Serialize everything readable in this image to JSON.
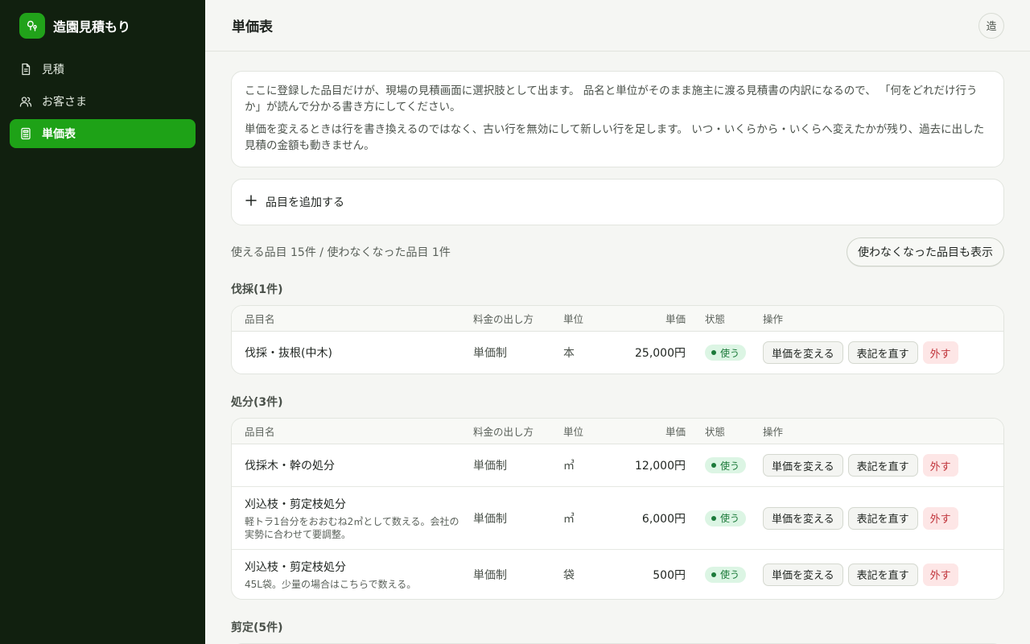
{
  "app": {
    "name": "造園見積もり",
    "logo_icon": "tree-icon",
    "brand_color": "#21a21a"
  },
  "sidebar": {
    "items": [
      {
        "label": "見積",
        "icon": "document-icon",
        "active": false
      },
      {
        "label": "お客さま",
        "icon": "users-icon",
        "active": false
      },
      {
        "label": "単価表",
        "icon": "calculator-icon",
        "active": true
      }
    ]
  },
  "header": {
    "title": "単価表",
    "avatar": "造"
  },
  "info": {
    "p1": "ここに登録した品目だけが、現場の見積画面に選択肢として出ます。 品名と単位がそのまま施主に渡る見積書の内訳になるので、 「何をどれだけ行うか」が読んで分かる書き方にしてください。",
    "p2": "単価を変えるときは行を書き換えるのではなく、古い行を無効にして新しい行を足します。 いつ・いくらから・いくらへ変えたかが残り、過去に出した見積の金額も動きません。"
  },
  "add_item": {
    "label": "品目を追加する",
    "icon": "plus-icon"
  },
  "summary": {
    "text": "使える品目 15件 / 使わなくなった品目 1件",
    "toggle_label": "使わなくなった品目も表示"
  },
  "columns": {
    "name": "品目名",
    "method": "料金の出し方",
    "unit": "単位",
    "price": "単価",
    "status": "状態",
    "ops": "操作"
  },
  "actions": {
    "change_price": "単価を変える",
    "fix_label": "表記を直す",
    "remove": "外す"
  },
  "status_colors": {
    "active_bg": "#dcf5e4",
    "active_text": "#1c7a3a",
    "danger_bg": "#fde6e6",
    "danger_text": "#c0333a"
  },
  "groups": [
    {
      "title": "伐採(1件)",
      "rows": [
        {
          "name": "伐採・抜根(中木)",
          "note": "",
          "method": "単価制",
          "unit": "本",
          "price": "25,000円",
          "status": "使う"
        }
      ]
    },
    {
      "title": "処分(3件)",
      "rows": [
        {
          "name": "伐採木・幹の処分",
          "note": "",
          "method": "単価制",
          "unit": "㎥",
          "price": "12,000円",
          "status": "使う"
        },
        {
          "name": "刈込枝・剪定枝処分",
          "note": "軽トラ1台分をおおむね2㎥として数える。会社の実勢に合わせて要調整。",
          "method": "単価制",
          "unit": "㎥",
          "price": "6,000円",
          "status": "使う"
        },
        {
          "name": "刈込枝・剪定枝処分",
          "note": "45L袋。少量の場合はこちらで数える。",
          "method": "単価制",
          "unit": "袋",
          "price": "500円",
          "status": "使う"
        }
      ]
    },
    {
      "title": "剪定(5件)",
      "rows": []
    }
  ]
}
